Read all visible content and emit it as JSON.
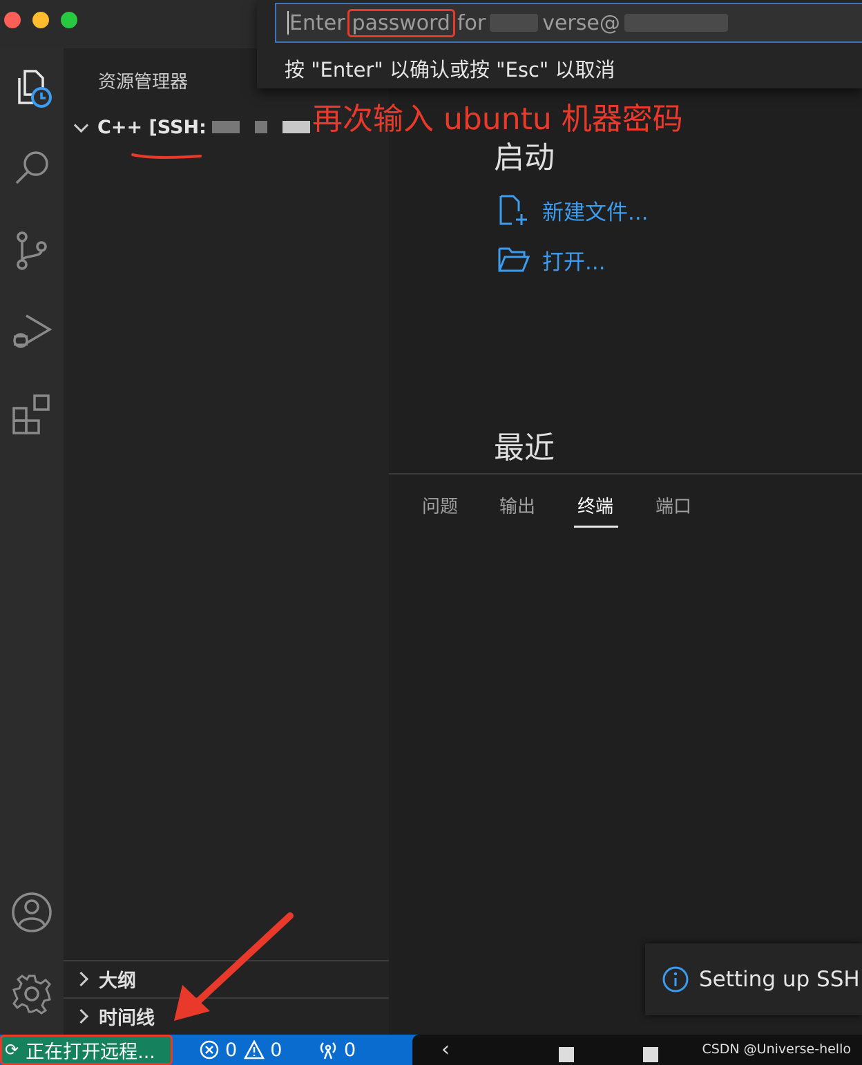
{
  "quick_input": {
    "prefix": "Enter",
    "highlight": "password",
    "suffix": "for",
    "tail": "verse@",
    "hint": "按 \"Enter\" 以确认或按 \"Esc\" 以取消"
  },
  "annotation_text": "再次输入 ubuntu 机器密码",
  "sidebar": {
    "title": "资源管理器",
    "folder": "C++ [SSH:",
    "sections": [
      {
        "label": "大纲"
      },
      {
        "label": "时间线"
      }
    ]
  },
  "welcome": {
    "start_heading": "启动",
    "new_file": "新建文件...",
    "open": "打开...",
    "recent_heading": "最近"
  },
  "panel": {
    "tabs": [
      {
        "label": "问题",
        "active": false
      },
      {
        "label": "输出",
        "active": false
      },
      {
        "label": "终端",
        "active": true
      },
      {
        "label": "端口",
        "active": false
      }
    ]
  },
  "toast": {
    "text": "Setting up SSH H"
  },
  "statusbar": {
    "remote": "正在打开远程...",
    "errors": "0",
    "warnings": "0",
    "ports": "0"
  },
  "watermark": "CSDN @Universe-hello",
  "colors": {
    "accent_link": "#3b9cf0",
    "statusbar": "#0a6ccf",
    "remote_indicator": "#16825d",
    "annotation_red": "#e8392a"
  }
}
